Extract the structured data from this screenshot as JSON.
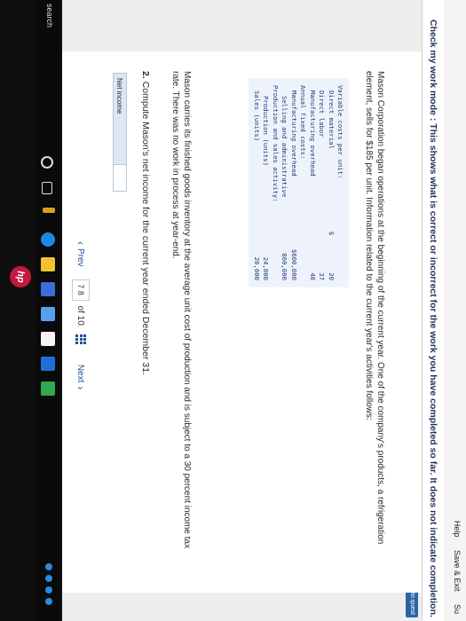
{
  "header": {
    "help": "Help",
    "save_exit": "Save & Exit",
    "submit": "Su"
  },
  "mode_banner": "Check my work mode : This shows what is correct or incorrect for the work you have completed so far. It does not indicate completion.",
  "return_button": "Return to quest",
  "intro": "Mason Corporation began operations at the beginning of the current year. One of the company's products, a refrigeration element, sells for $185 per unit. Information related to the current year's activities follows:",
  "cost_table": [
    {
      "label": "Variable costs per unit:",
      "currency": "",
      "value": "",
      "indent": 0
    },
    {
      "label": "Direct material",
      "currency": "$",
      "value": "20",
      "indent": 1
    },
    {
      "label": "Direct labor",
      "currency": "",
      "value": "37",
      "indent": 1
    },
    {
      "label": "Manufacturing overhead",
      "currency": "",
      "value": "48",
      "indent": 1
    },
    {
      "label": "Annual fixed costs:",
      "currency": "",
      "value": "",
      "indent": 0
    },
    {
      "label": "Manufacturing overhead",
      "currency": "",
      "value": "$600,000",
      "indent": 1
    },
    {
      "label": "Selling and administrative",
      "currency": "",
      "value": "860,000",
      "indent": 2
    },
    {
      "label": "Production and sales activity:",
      "currency": "",
      "value": "",
      "indent": 0
    },
    {
      "label": "Production (units)",
      "currency": "",
      "value": "24,000",
      "indent": 2
    },
    {
      "label": "Sales (units)",
      "currency": "",
      "value": "20,000",
      "indent": 1
    }
  ],
  "carries_text": "Mason carries its finished goods inventory at the average unit cost of production and is subject to a 30 percent income tax rate. There was no work in process at year-end.",
  "question": {
    "number": "2.",
    "text": "Compute Mason's net income for the current year ended December 31."
  },
  "answer": {
    "label": "Net income",
    "value": ""
  },
  "pager": {
    "prev": "Prev",
    "current": "7",
    "next_page": "8",
    "of": "of 10",
    "next": "Next"
  },
  "taskbar": {
    "search": "search"
  },
  "brand": "hp",
  "colors": {
    "accent": "#2b64a8",
    "table_bg": "#eef3fb",
    "link": "#1f4f95",
    "hp_red": "#c21a3a"
  }
}
